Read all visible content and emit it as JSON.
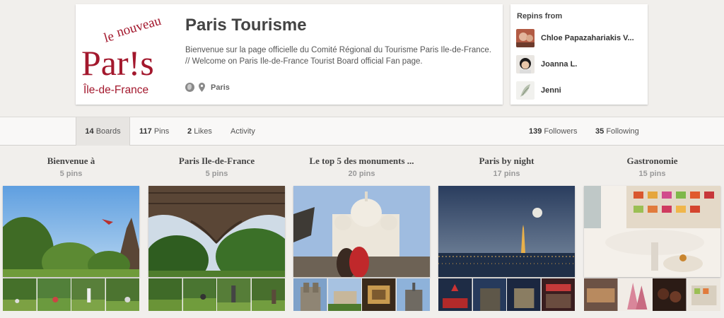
{
  "profile": {
    "logo_text": {
      "le": "le",
      "nouveau": "nouveau",
      "paris": "Par!s",
      "region": "Île-de-France"
    },
    "name": "Paris Tourisme",
    "description": "Bienvenue sur la page officielle du Comité Régional du Tourisme Paris Ile-de-France. // Welcome on Paris Ile-de-France Tourist Board official Fan page.",
    "location": "Paris",
    "icons": [
      "globe-icon",
      "map-pin-icon"
    ],
    "brand_color": "#a3182d"
  },
  "repins": {
    "title": "Repins from",
    "users": [
      {
        "name": "Chloe Papazahariakis V..."
      },
      {
        "name": "Joanna L."
      },
      {
        "name": "Jenni"
      }
    ]
  },
  "tabs": {
    "boards": {
      "count": "14",
      "label": "Boards"
    },
    "pins": {
      "count": "117",
      "label": "Pins"
    },
    "likes": {
      "count": "2",
      "label": "Likes"
    },
    "activity": {
      "label": "Activity"
    },
    "followers": {
      "count": "139",
      "label": "Followers"
    },
    "following": {
      "count": "35",
      "label": "Following"
    }
  },
  "boards": [
    {
      "title": "Bienvenue à",
      "pins": "5 pins"
    },
    {
      "title": "Paris Ile-de-France",
      "pins": "5 pins"
    },
    {
      "title": "Le top 5 des monuments ...",
      "pins": "20 pins"
    },
    {
      "title": "Paris by night",
      "pins": "17 pins"
    },
    {
      "title": "Gastronomie",
      "pins": "15 pins"
    }
  ]
}
